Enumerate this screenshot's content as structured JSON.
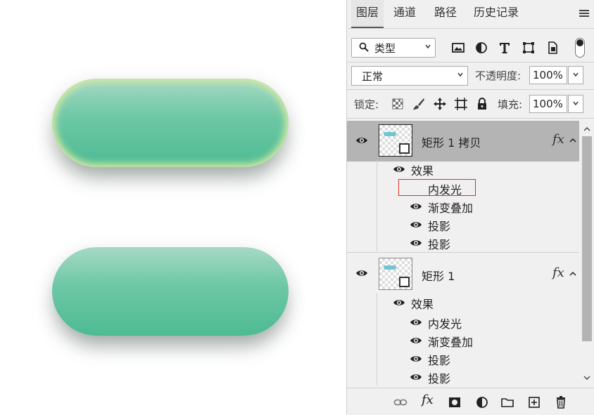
{
  "tabs": [
    "图层",
    "通道",
    "路径",
    "历史记录"
  ],
  "filter": {
    "label": "类型"
  },
  "blend_mode": "正常",
  "opacity": {
    "label": "不透明度:",
    "value": "100%"
  },
  "lock": {
    "label": "锁定:"
  },
  "fill": {
    "label": "填充:",
    "value": "100%"
  },
  "layers": [
    {
      "name": "矩形 1 拷贝",
      "fx": "fx",
      "effects_label": "效果",
      "effects": [
        "内发光",
        "渐变叠加",
        "投影",
        "投影"
      ]
    },
    {
      "name": "矩形 1",
      "fx": "fx",
      "effects_label": "效果",
      "effects": [
        "内发光",
        "渐变叠加",
        "投影",
        "投影"
      ]
    }
  ],
  "colors": {
    "pill_top": "#a6d9c3",
    "pill_bottom": "#4dbb93",
    "inner_glow": "#d2e8a6",
    "highlight": "#d9302a"
  }
}
